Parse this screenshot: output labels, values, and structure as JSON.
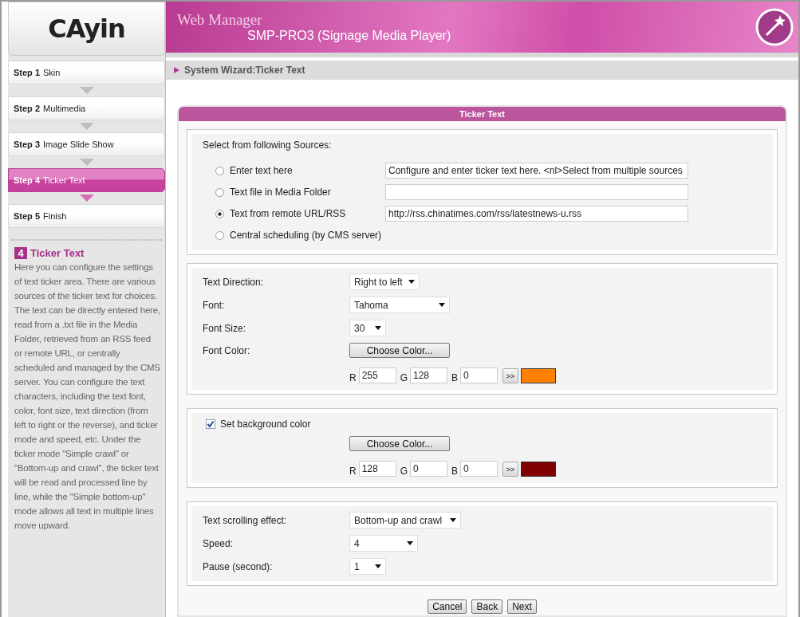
{
  "header": {
    "logo": "CAyin",
    "app_title": "Web Manager",
    "device": "SMP-PRO3 (Signage Media Player)"
  },
  "steps": [
    {
      "number": "Step 1",
      "label": "Skin",
      "selected": false
    },
    {
      "number": "Step 2",
      "label": "Multimedia",
      "selected": false
    },
    {
      "number": "Step 3",
      "label": "Image Slide Show",
      "selected": false
    },
    {
      "number": "Step 4",
      "label": "Ticker Text",
      "selected": true
    },
    {
      "number": "Step 5",
      "label": "Finish",
      "selected": false
    }
  ],
  "help": {
    "badge": "4",
    "title": "Ticker Text",
    "text": "Here you can configure the settings of text ticker area. There are various sources of the ticker text for choices. The text can be directly entered here, read from a .txt file in the Media Folder, retrieved from an RSS feed or remote URL, or centrally scheduled and managed by the CMS server. You can configure the text characters, including the text font, color, font size, text direction (from left to right or the reverse), and ticker mode and speed, etc. Under the ticker mode \"Simple crawl\" or \"Bottom-up and crawl\", the ticker text will be read and processed line by line, while the \"Simple bottom-up\" mode allows all text in multiple lines move upward."
  },
  "breadcrumb": "System Wizard:Ticker Text",
  "panel_title": "Ticker Text",
  "sources": {
    "heading": "Select from following Sources:",
    "options": [
      {
        "label": "Enter text here",
        "selected": false,
        "kind": "field",
        "value": "Configure and enter ticker text here. <nl>Select from multiple sources"
      },
      {
        "label": "Text file in Media Folder",
        "selected": false,
        "kind": "field"
      },
      {
        "label": "Text from remote URL/RSS",
        "selected": true,
        "kind": "field",
        "value": "http://rss.chinatimes.com/rss/latestnews-u.rss"
      },
      {
        "label": "Central scheduling (by CMS server)",
        "selected": false,
        "kind": "plain"
      }
    ]
  },
  "text_settings": [
    {
      "label": "Text Direction:",
      "value": "Right to left",
      "kind": "select"
    },
    {
      "label": "Font:",
      "value": "Tahoma",
      "kind": "select"
    },
    {
      "label": "Font Size:",
      "value": "30",
      "kind": "select"
    },
    {
      "label": "Font Color:",
      "kind": "color",
      "button": "Choose Color...",
      "channels": [
        {
          "label": "R",
          "value": "255"
        },
        {
          "label": "G",
          "value": "128"
        },
        {
          "label": "B",
          "value": "0"
        }
      ],
      "apply": ">>",
      "color": "#ff8000"
    }
  ],
  "background": {
    "label": "Set background color",
    "checked": true,
    "button": "Choose Color...",
    "channels": [
      {
        "label": "R",
        "value": "128"
      },
      {
        "label": "G",
        "value": "0"
      },
      {
        "label": "B",
        "value": "0"
      }
    ],
    "apply": ">>",
    "color": "#800000"
  },
  "scrolling": [
    {
      "label": "Text scrolling effect:",
      "value": "Bottom-up and crawl"
    },
    {
      "label": "Speed:",
      "value": "4"
    },
    {
      "label": "Pause (second):",
      "value": "1"
    }
  ],
  "buttons": [
    "Cancel",
    "Back",
    "Next"
  ]
}
